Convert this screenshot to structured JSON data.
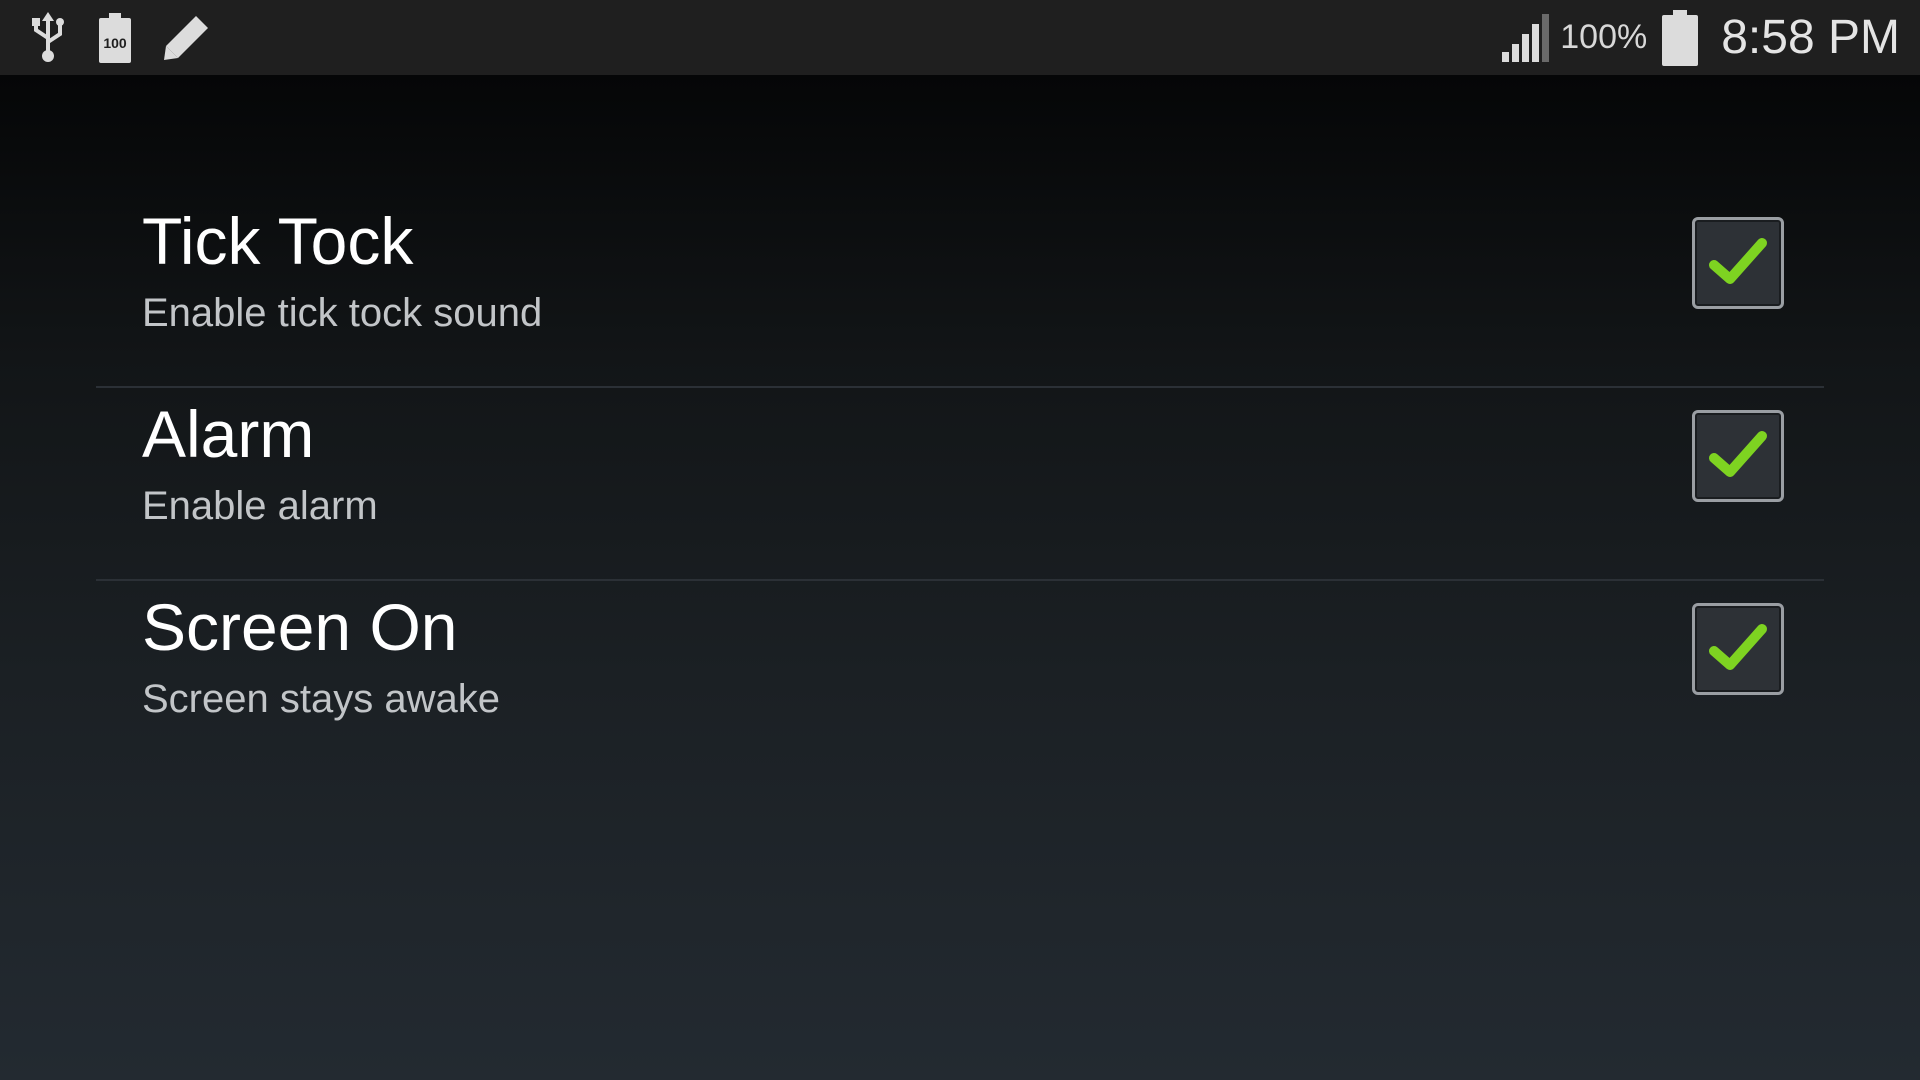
{
  "status_bar": {
    "icons_left": [
      "usb-icon",
      "battery-100-notification-icon",
      "pencil-icon"
    ],
    "battery_notification_label": "100",
    "signal_icon": "signal-bars-icon",
    "battery_percent": "100%",
    "battery_icon": "battery-full-icon",
    "time": "8:58 PM"
  },
  "preferences": [
    {
      "title": "Tick Tock",
      "summary": "Enable tick tock sound",
      "checked": true
    },
    {
      "title": "Alarm",
      "summary": "Enable alarm",
      "checked": true
    },
    {
      "title": "Screen On",
      "summary": "Screen stays awake",
      "checked": true
    }
  ],
  "colors": {
    "check_mark": "#7ed321",
    "status_bar_bg": "#1f1f1f"
  }
}
